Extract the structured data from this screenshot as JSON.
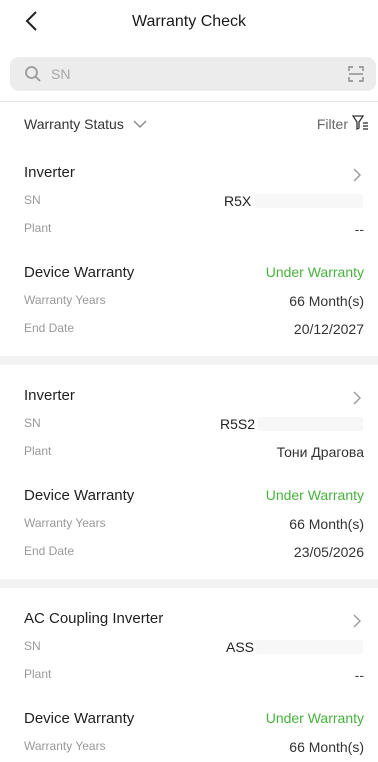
{
  "header": {
    "title": "Warranty Check"
  },
  "search": {
    "placeholder": "SN"
  },
  "filter_bar": {
    "status_label": "Warranty Status",
    "filter_label": "Filter"
  },
  "cards": [
    {
      "type": "Inverter",
      "sn_label": "SN",
      "sn_value": "R5X",
      "plant_label": "Plant",
      "plant_value": "--",
      "warranty_label": "Device Warranty",
      "warranty_status": "Under Warranty",
      "years_label": "Warranty Years",
      "years_value": "66 Month(s)",
      "end_label": "End Date",
      "end_value": "20/12/2027"
    },
    {
      "type": "Inverter",
      "sn_label": "SN",
      "sn_value": "R5S2",
      "plant_label": "Plant",
      "plant_value": "Тони Драгова",
      "warranty_label": "Device Warranty",
      "warranty_status": "Under Warranty",
      "years_label": "Warranty Years",
      "years_value": "66 Month(s)",
      "end_label": "End Date",
      "end_value": "23/05/2026"
    },
    {
      "type": "AC Coupling Inverter",
      "sn_label": "SN",
      "sn_value": "ASS",
      "plant_label": "Plant",
      "plant_value": "--",
      "warranty_label": "Device Warranty",
      "warranty_status": "Under Warranty",
      "years_label": "Warranty Years",
      "years_value": "66 Month(s)"
    }
  ],
  "colors": {
    "status_green": "#46b33c",
    "search_bg": "#ececec"
  }
}
